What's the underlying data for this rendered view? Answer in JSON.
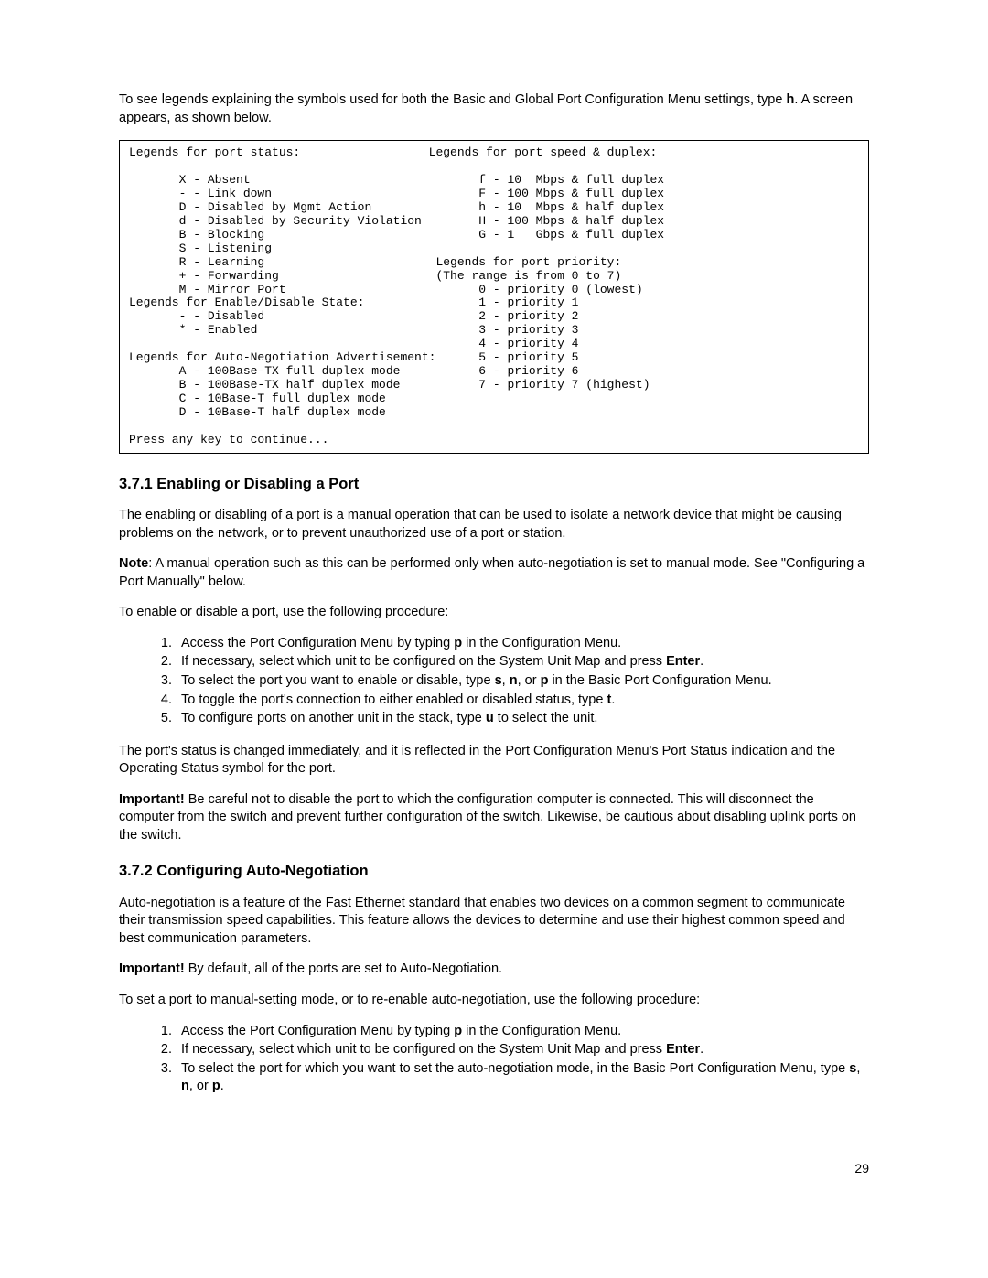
{
  "intro": {
    "text_a": "To see legends explaining the symbols used for both the Basic and Global Port Configuration Menu settings, type ",
    "key": "h",
    "text_b": ". A screen appears, as shown below."
  },
  "codebox": "Legends for port status:                  Legends for port speed & duplex:\n\n       X - Absent                                f - 10  Mbps & full duplex\n       - - Link down                             F - 100 Mbps & full duplex\n       D - Disabled by Mgmt Action               h - 10  Mbps & half duplex\n       d - Disabled by Security Violation        H - 100 Mbps & half duplex\n       B - Blocking                              G - 1   Gbps & full duplex\n       S - Listening\n       R - Learning                        Legends for port priority:\n       + - Forwarding                      (The range is from 0 to 7)\n       M - Mirror Port                           0 - priority 0 (lowest)\nLegends for Enable/Disable State:                1 - priority 1\n       - - Disabled                              2 - priority 2\n       * - Enabled                               3 - priority 3\n                                                 4 - priority 4\nLegends for Auto-Negotiation Advertisement:      5 - priority 5\n       A - 100Base-TX full duplex mode           6 - priority 6\n       B - 100Base-TX half duplex mode           7 - priority 7 (highest)\n       C - 10Base-T full duplex mode\n       D - 10Base-T half duplex mode\n\nPress any key to continue...",
  "sec371": {
    "heading": "3.7.1 Enabling or Disabling a Port",
    "p1": "The enabling or disabling of a port is a manual operation that can be used to isolate a network device that might be causing problems on the network, or to prevent unauthorized use of a port or station.",
    "note_label": "Note",
    "note_body": ": A manual operation such as this can be performed only when auto-negotiation is set to manual mode. See \"Configuring a Port Manually\" below.",
    "p2": "To enable or disable a port, use the following procedure:",
    "steps": {
      "s1a": "Access the Port Configuration Menu by typing ",
      "s1k": "p",
      "s1b": " in the Configuration Menu.",
      "s2a": "If necessary, select which unit to be configured on the System Unit Map and press ",
      "s2k": "Enter",
      "s2b": ".",
      "s3a": "To select the port you want to enable or disable, type ",
      "s3k1": "s",
      "s3m1": ", ",
      "s3k2": "n",
      "s3m2": ", or ",
      "s3k3": "p",
      "s3b": " in the Basic Port Configuration Menu.",
      "s4a": "To toggle the port's connection to either enabled or disabled status, type ",
      "s4k": "t",
      "s4b": ".",
      "s5a": "To configure ports on another unit in the stack, type ",
      "s5k": "u",
      "s5b": " to select the unit."
    },
    "p3": "The port's status is changed immediately, and it is reflected in the Port Configuration Menu's Port Status indication and the Operating Status symbol for the port.",
    "imp_label": "Important!",
    "imp_body": " Be careful not to disable the port to which the configuration computer is connected.  This will disconnect the computer from the switch and prevent further configuration of the switch. Likewise, be cautious about disabling uplink ports on the switch."
  },
  "sec372": {
    "heading": "3.7.2 Configuring Auto-Negotiation",
    "p1": "Auto-negotiation is a feature of the Fast Ethernet standard that enables two devices on a common segment to communicate their transmission speed capabilities. This feature allows the devices to determine and use their highest common speed and best communication parameters.",
    "imp_label": "Important!",
    "imp_body": " By default, all of the ports are set to Auto-Negotiation.",
    "p2": "To set a port to manual-setting mode, or to re-enable auto-negotiation, use the following procedure:",
    "steps": {
      "s1a": "Access the Port Configuration Menu by typing ",
      "s1k": "p",
      "s1b": " in the Configuration Menu.",
      "s2a": "If necessary, select which unit to be configured on the System Unit Map and press ",
      "s2k": "Enter",
      "s2b": ".",
      "s3a": "To select the port for which you want to set the auto-negotiation mode, in the Basic Port Configuration Menu, type ",
      "s3k1": "s",
      "s3m1": ", ",
      "s3k2": "n",
      "s3m2": ", or ",
      "s3k3": "p",
      "s3b": "."
    }
  },
  "page_number": "29"
}
